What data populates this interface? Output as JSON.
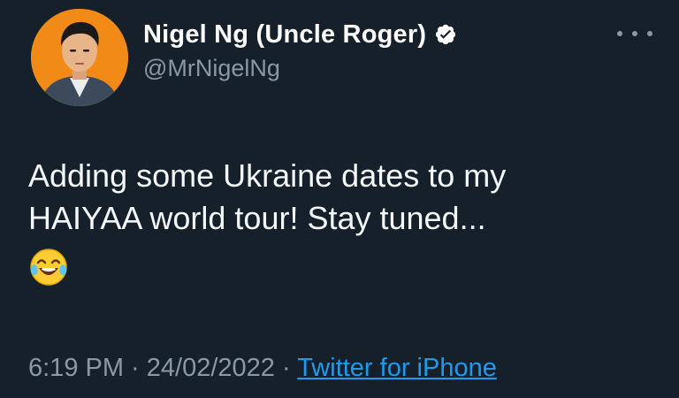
{
  "author": {
    "display_name": "Nigel Ng (Uncle Roger)",
    "handle": "@MrNigelNg",
    "verified": true,
    "avatar_icon": "profile-photo",
    "avatar_bg_color": "#f28a18"
  },
  "tweet": {
    "line1": "Adding some Ukraine dates to my",
    "line2": "HAIYAA world tour! Stay tuned...",
    "emoji_icon": "face-with-tears-of-joy-emoji"
  },
  "meta": {
    "time": "6:19 PM",
    "sep1": " · ",
    "date": "24/02/2022",
    "sep2": " · ",
    "source": "Twitter for iPhone"
  },
  "colors": {
    "background": "#15202b",
    "primary_text": "#ffffff",
    "secondary_text": "#8b98a5",
    "link": "#1d9bf0"
  },
  "icons": {
    "more": "more-options-icon",
    "verified": "verified-badge-icon"
  }
}
